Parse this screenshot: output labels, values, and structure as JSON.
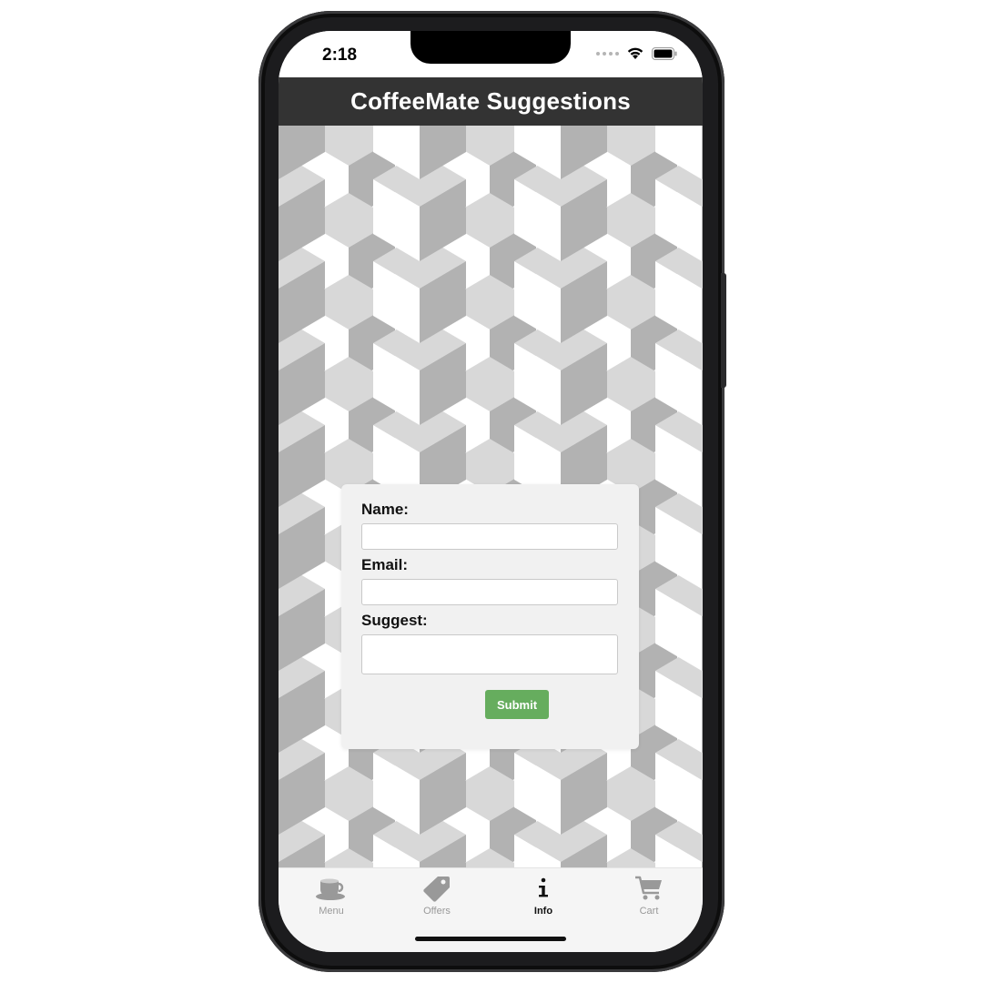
{
  "status_bar": {
    "time": "2:18"
  },
  "header": {
    "title": "CoffeeMate Suggestions"
  },
  "form": {
    "name_label": "Name:",
    "name_value": "",
    "email_label": "Email:",
    "email_value": "",
    "suggest_label": "Suggest:",
    "suggest_value": "",
    "submit_label": "Submit"
  },
  "tab_bar": {
    "items": [
      {
        "label": "Menu",
        "icon": "coffee-cup-icon",
        "active": false
      },
      {
        "label": "Offers",
        "icon": "tag-icon",
        "active": false
      },
      {
        "label": "Info",
        "icon": "info-icon",
        "active": true
      },
      {
        "label": "Cart",
        "icon": "cart-icon",
        "active": false
      }
    ]
  },
  "colors": {
    "header_bg": "#333333",
    "submit_bg": "#66ad5e",
    "card_bg": "#f1f1f1",
    "cube_light": "#d8d8d8",
    "cube_dark": "#b2b2b2",
    "cube_white": "#ffffff",
    "tab_inactive": "#999999",
    "tab_active": "#111111"
  }
}
